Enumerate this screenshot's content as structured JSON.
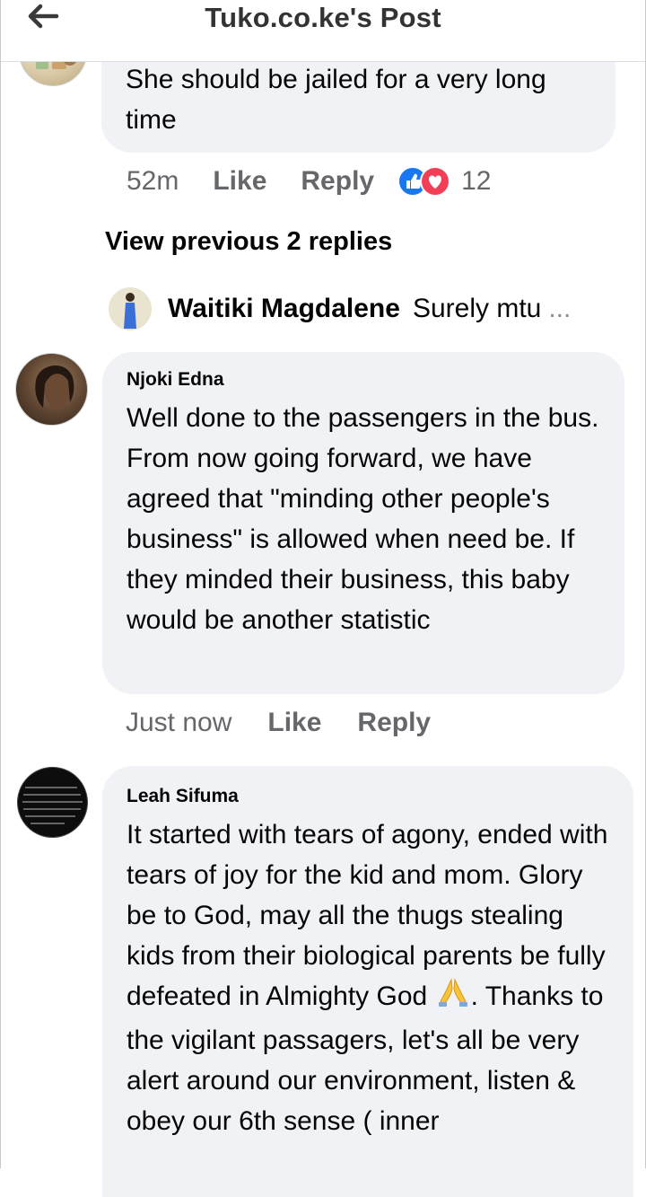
{
  "header": {
    "title": "Tuko.co.ke's Post"
  },
  "comments": [
    {
      "text": "She should be jailed for a very long time",
      "time": "52m",
      "like_label": "Like",
      "reply_label": "Reply",
      "reaction_count": "12"
    },
    {
      "author": "Njoki Edna",
      "text": "Well done to the passengers in the bus. From now going forward, we have agreed that \"minding other people's business\" is allowed when need be. If they minded their business, this baby would be another statistic",
      "time": "Just now",
      "like_label": "Like",
      "reply_label": "Reply"
    },
    {
      "author": "Leah Sifuma",
      "text_before_emoji": "It started with tears of agony, ended with tears of joy for the kid and mom. Glory be to God, may all the thugs stealing kids from their biological parents be fully defeated in Almighty God",
      "text_after_emoji": ".  Thanks to the vigilant passagers, let's all be very alert around our environment, listen & obey our 6th sense ( inner"
    }
  ],
  "view_previous": "View previous 2 replies",
  "reply_preview": {
    "name": "Waitiki Magdalene",
    "text": "Surely mtu",
    "ellipsis": "..."
  },
  "icons": {
    "back": "arrow-left-icon",
    "like_reaction": "thumbs-up-icon",
    "love_reaction": "heart-icon",
    "emoji": "praying-hands-emoji"
  },
  "colors": {
    "bubble": "#f0f2f5",
    "meta_text": "#65676b",
    "like_blue": "#1877f2",
    "love_red": "#f33e58"
  }
}
